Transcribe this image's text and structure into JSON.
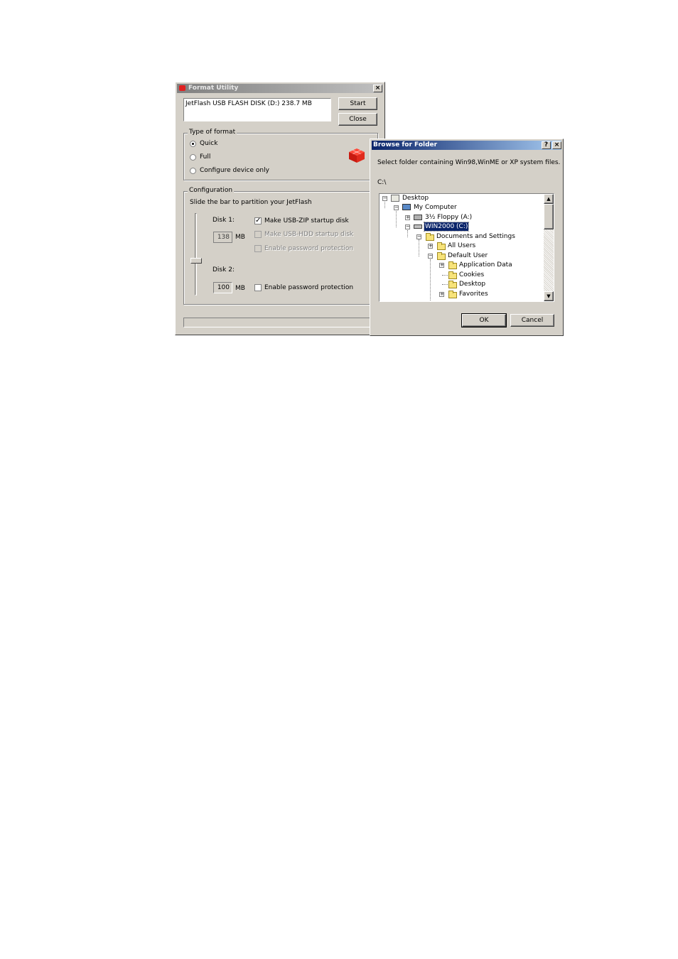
{
  "format_utility": {
    "title": "Format Utility",
    "device_text": "JetFlash USB FLASH DISK (D:)  238.7 MB",
    "start_label": "Start",
    "close_label": "Close",
    "type_group_label": "Type of format",
    "options": [
      "Quick",
      "Full",
      "Configure device only"
    ],
    "selected_option": "Quick",
    "config_group_label": "Configuration",
    "config_hint": "Slide the bar to partition your JetFlash",
    "disk1_label": "Disk 1:",
    "disk1_size": "138",
    "disk2_label": "Disk 2:",
    "disk2_size": "100",
    "unit": "MB",
    "disk1_options": [
      {
        "label": "Make USB-ZIP startup disk",
        "checked": true,
        "enabled": true
      },
      {
        "label": "Make USB-HDD startup disk",
        "checked": false,
        "enabled": false
      },
      {
        "label": "Enable password protection",
        "checked": false,
        "enabled": false
      }
    ],
    "disk2_option": {
      "label": "Enable password protection",
      "checked": false,
      "enabled": true
    },
    "close_x": "×"
  },
  "browse_dialog": {
    "title": "Browse for Folder",
    "help_btn": "?",
    "close_btn": "×",
    "instruction": "Select folder containing Win98,WinME or XP system files.",
    "current_path": "C:\\",
    "tree": [
      {
        "label": "Desktop",
        "icon": "desktop-icon",
        "level": 0,
        "expander": "-"
      },
      {
        "label": "My Computer",
        "icon": "computer-icon",
        "level": 1,
        "expander": "-"
      },
      {
        "label": "3½ Floppy (A:)",
        "icon": "floppy-icon",
        "level": 2,
        "expander": "+"
      },
      {
        "label": "WIN2000 (C:)",
        "icon": "drive-icon",
        "level": 2,
        "expander": "-",
        "selected": true
      },
      {
        "label": "Documents and Settings",
        "icon": "folder-icon",
        "level": 3,
        "expander": "-"
      },
      {
        "label": "All Users",
        "icon": "folder-icon",
        "level": 4,
        "expander": "+"
      },
      {
        "label": "Default User",
        "icon": "folder-icon",
        "level": 4,
        "expander": "-"
      },
      {
        "label": "Application Data",
        "icon": "folder-icon",
        "level": 5,
        "expander": "+"
      },
      {
        "label": "Cookies",
        "icon": "folder-icon",
        "level": 5,
        "expander": ""
      },
      {
        "label": "Desktop",
        "icon": "folder-icon",
        "level": 5,
        "expander": ""
      },
      {
        "label": "Favorites",
        "icon": "folder-icon",
        "level": 5,
        "expander": "+"
      }
    ],
    "ok_label": "OK",
    "cancel_label": "Cancel"
  },
  "colors": {
    "face": "#d4d0c8",
    "title_active_start": "#0a246a",
    "title_active_end": "#a6caf0",
    "title_inactive_start": "#808080",
    "title_inactive_end": "#c0c0c0",
    "selection": "#0a246a"
  }
}
